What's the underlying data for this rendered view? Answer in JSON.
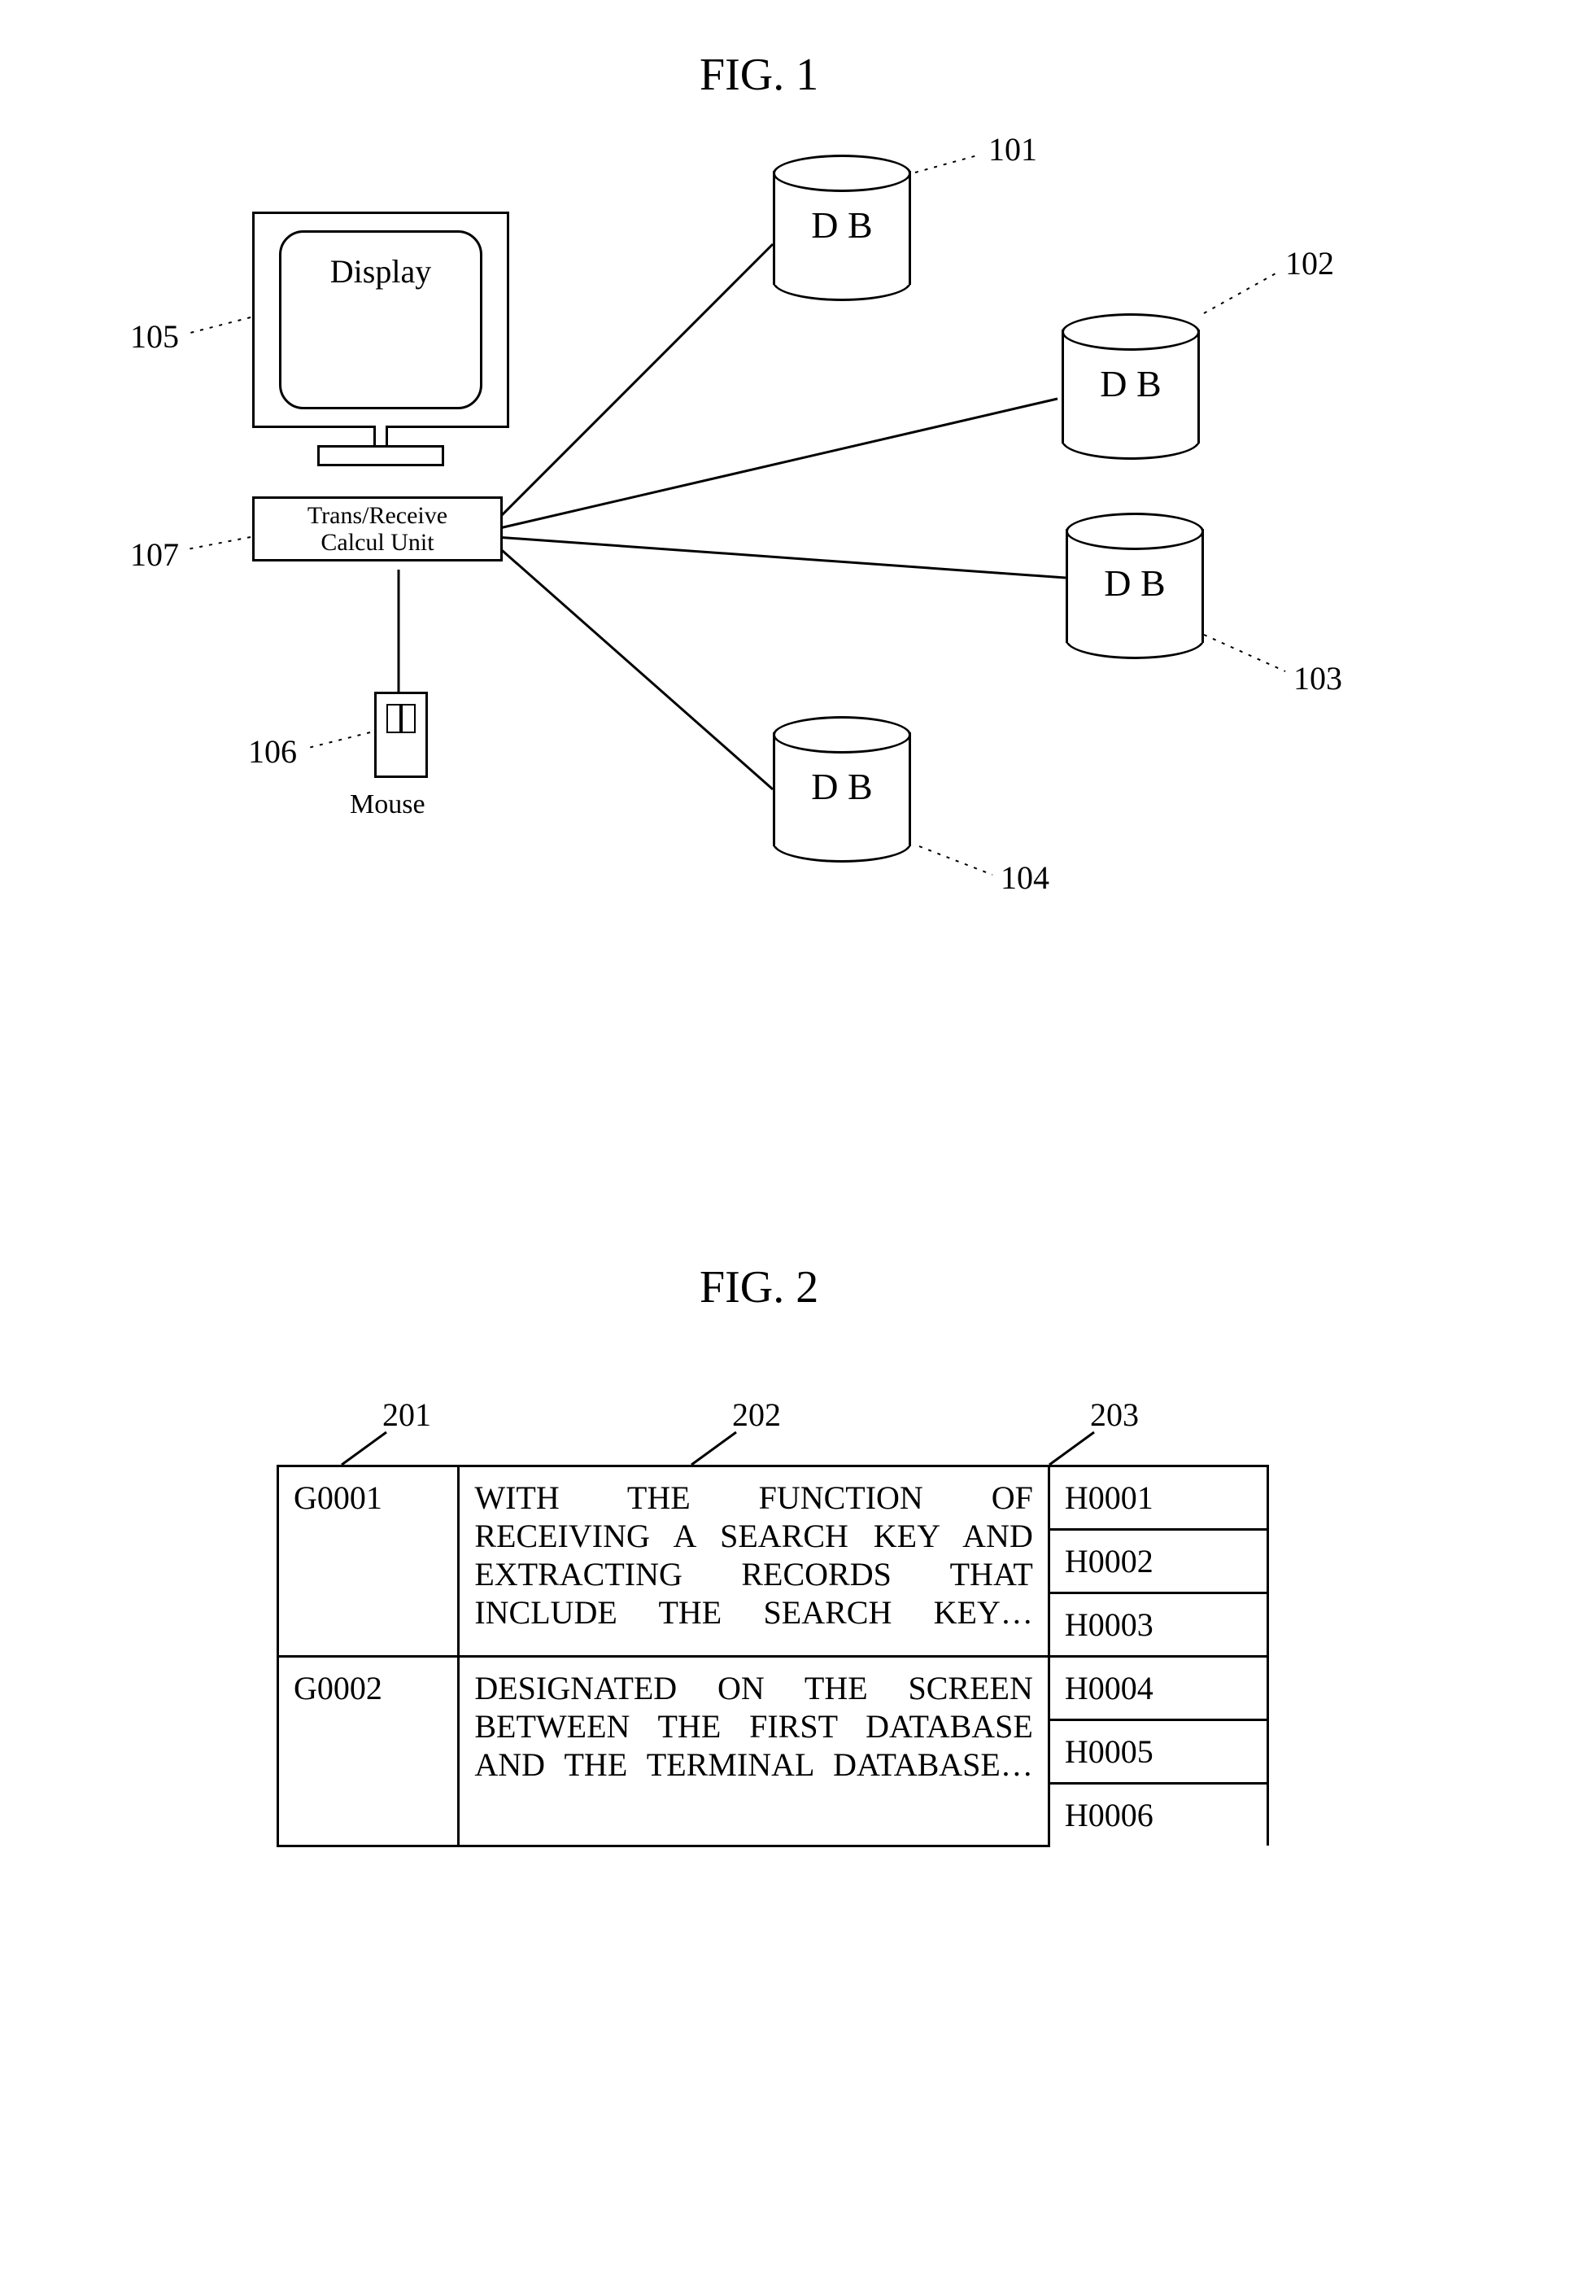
{
  "figures": {
    "fig1": {
      "label": "FIG. 1",
      "display_text": "Display",
      "unit_line1": "Trans/Receive",
      "unit_line2": "Calcul   Unit",
      "mouse_label": "Mouse",
      "db_label": "D B",
      "refs": {
        "r101": "101",
        "r102": "102",
        "r103": "103",
        "r104": "104",
        "r105": "105",
        "r106": "106",
        "r107": "107"
      }
    },
    "fig2": {
      "label": "FIG. 2",
      "col_refs": {
        "c201": "201",
        "c202": "202",
        "c203": "203"
      },
      "rows": [
        {
          "id": "G0001",
          "text": "WITH THE FUNCTION OF RECEIVING A SEARCH KEY AND EXTRACTING RECORDS THAT INCLUDE THE SEARCH KEY…",
          "h": [
            "H0001",
            "H0002",
            "H0003"
          ]
        },
        {
          "id": "G0002",
          "text": "DESIGNATED ON THE SCREEN BETWEEN THE FIRST DATABASE AND THE TERMINAL DATABASE…",
          "h": [
            "H0004",
            "H0005",
            "H0006"
          ]
        }
      ]
    }
  }
}
